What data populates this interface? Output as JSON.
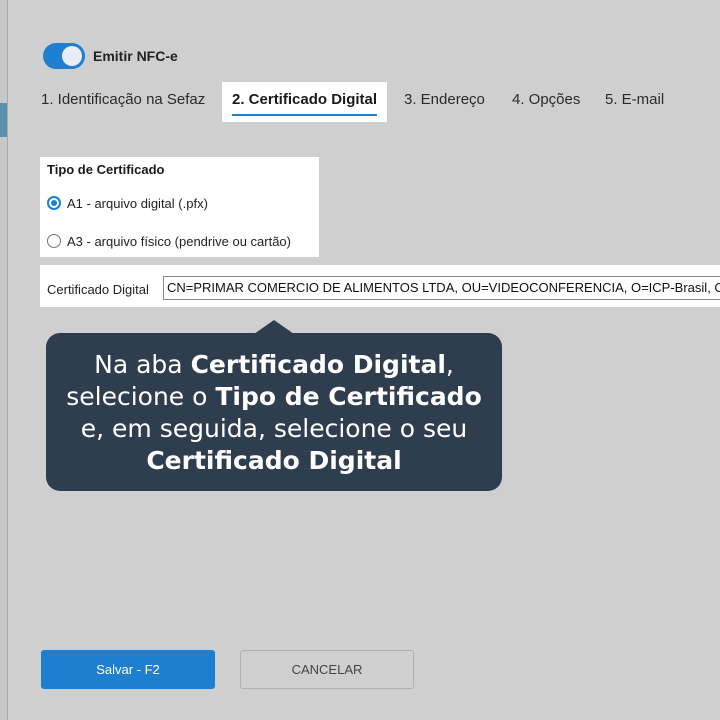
{
  "nfce_toggle": {
    "label": "Emitir NFC-e",
    "on": true
  },
  "tabs": [
    {
      "label": "1. Identificação na Sefaz"
    },
    {
      "label": "2. Certificado Digital",
      "active": true
    },
    {
      "label": "3. Endereço"
    },
    {
      "label": "4. Opções"
    },
    {
      "label": "5. E-mail"
    }
  ],
  "cert_type": {
    "title": "Tipo de Certificado",
    "options": [
      {
        "label": "A1 - arquivo digital (.pfx)",
        "checked": true
      },
      {
        "label": "A3 - arquivo físico (pendrive ou cartão)",
        "checked": false
      }
    ]
  },
  "cert": {
    "label": "Certificado Digital",
    "value": "CN=PRIMAR COMERCIO DE ALIMENTOS LTDA, OU=VIDEOCONFERENCIA, O=ICP-Brasil, C=BR"
  },
  "tooltip": {
    "l1a": "Na aba ",
    "l1b": "Certificado Digital",
    "l1c": ",",
    "l2a": "selecione o ",
    "l2b": "Tipo de Certificado",
    "l3": "e, em seguida, selecione o seu",
    "l4": "Certificado Digital"
  },
  "buttons": {
    "save": "Salvar - F2",
    "cancel": "CANCELAR"
  },
  "colors": {
    "accent": "#1e7fd0",
    "tooltip_bg": "#2f3e4e",
    "background": "#cfcfcf"
  }
}
